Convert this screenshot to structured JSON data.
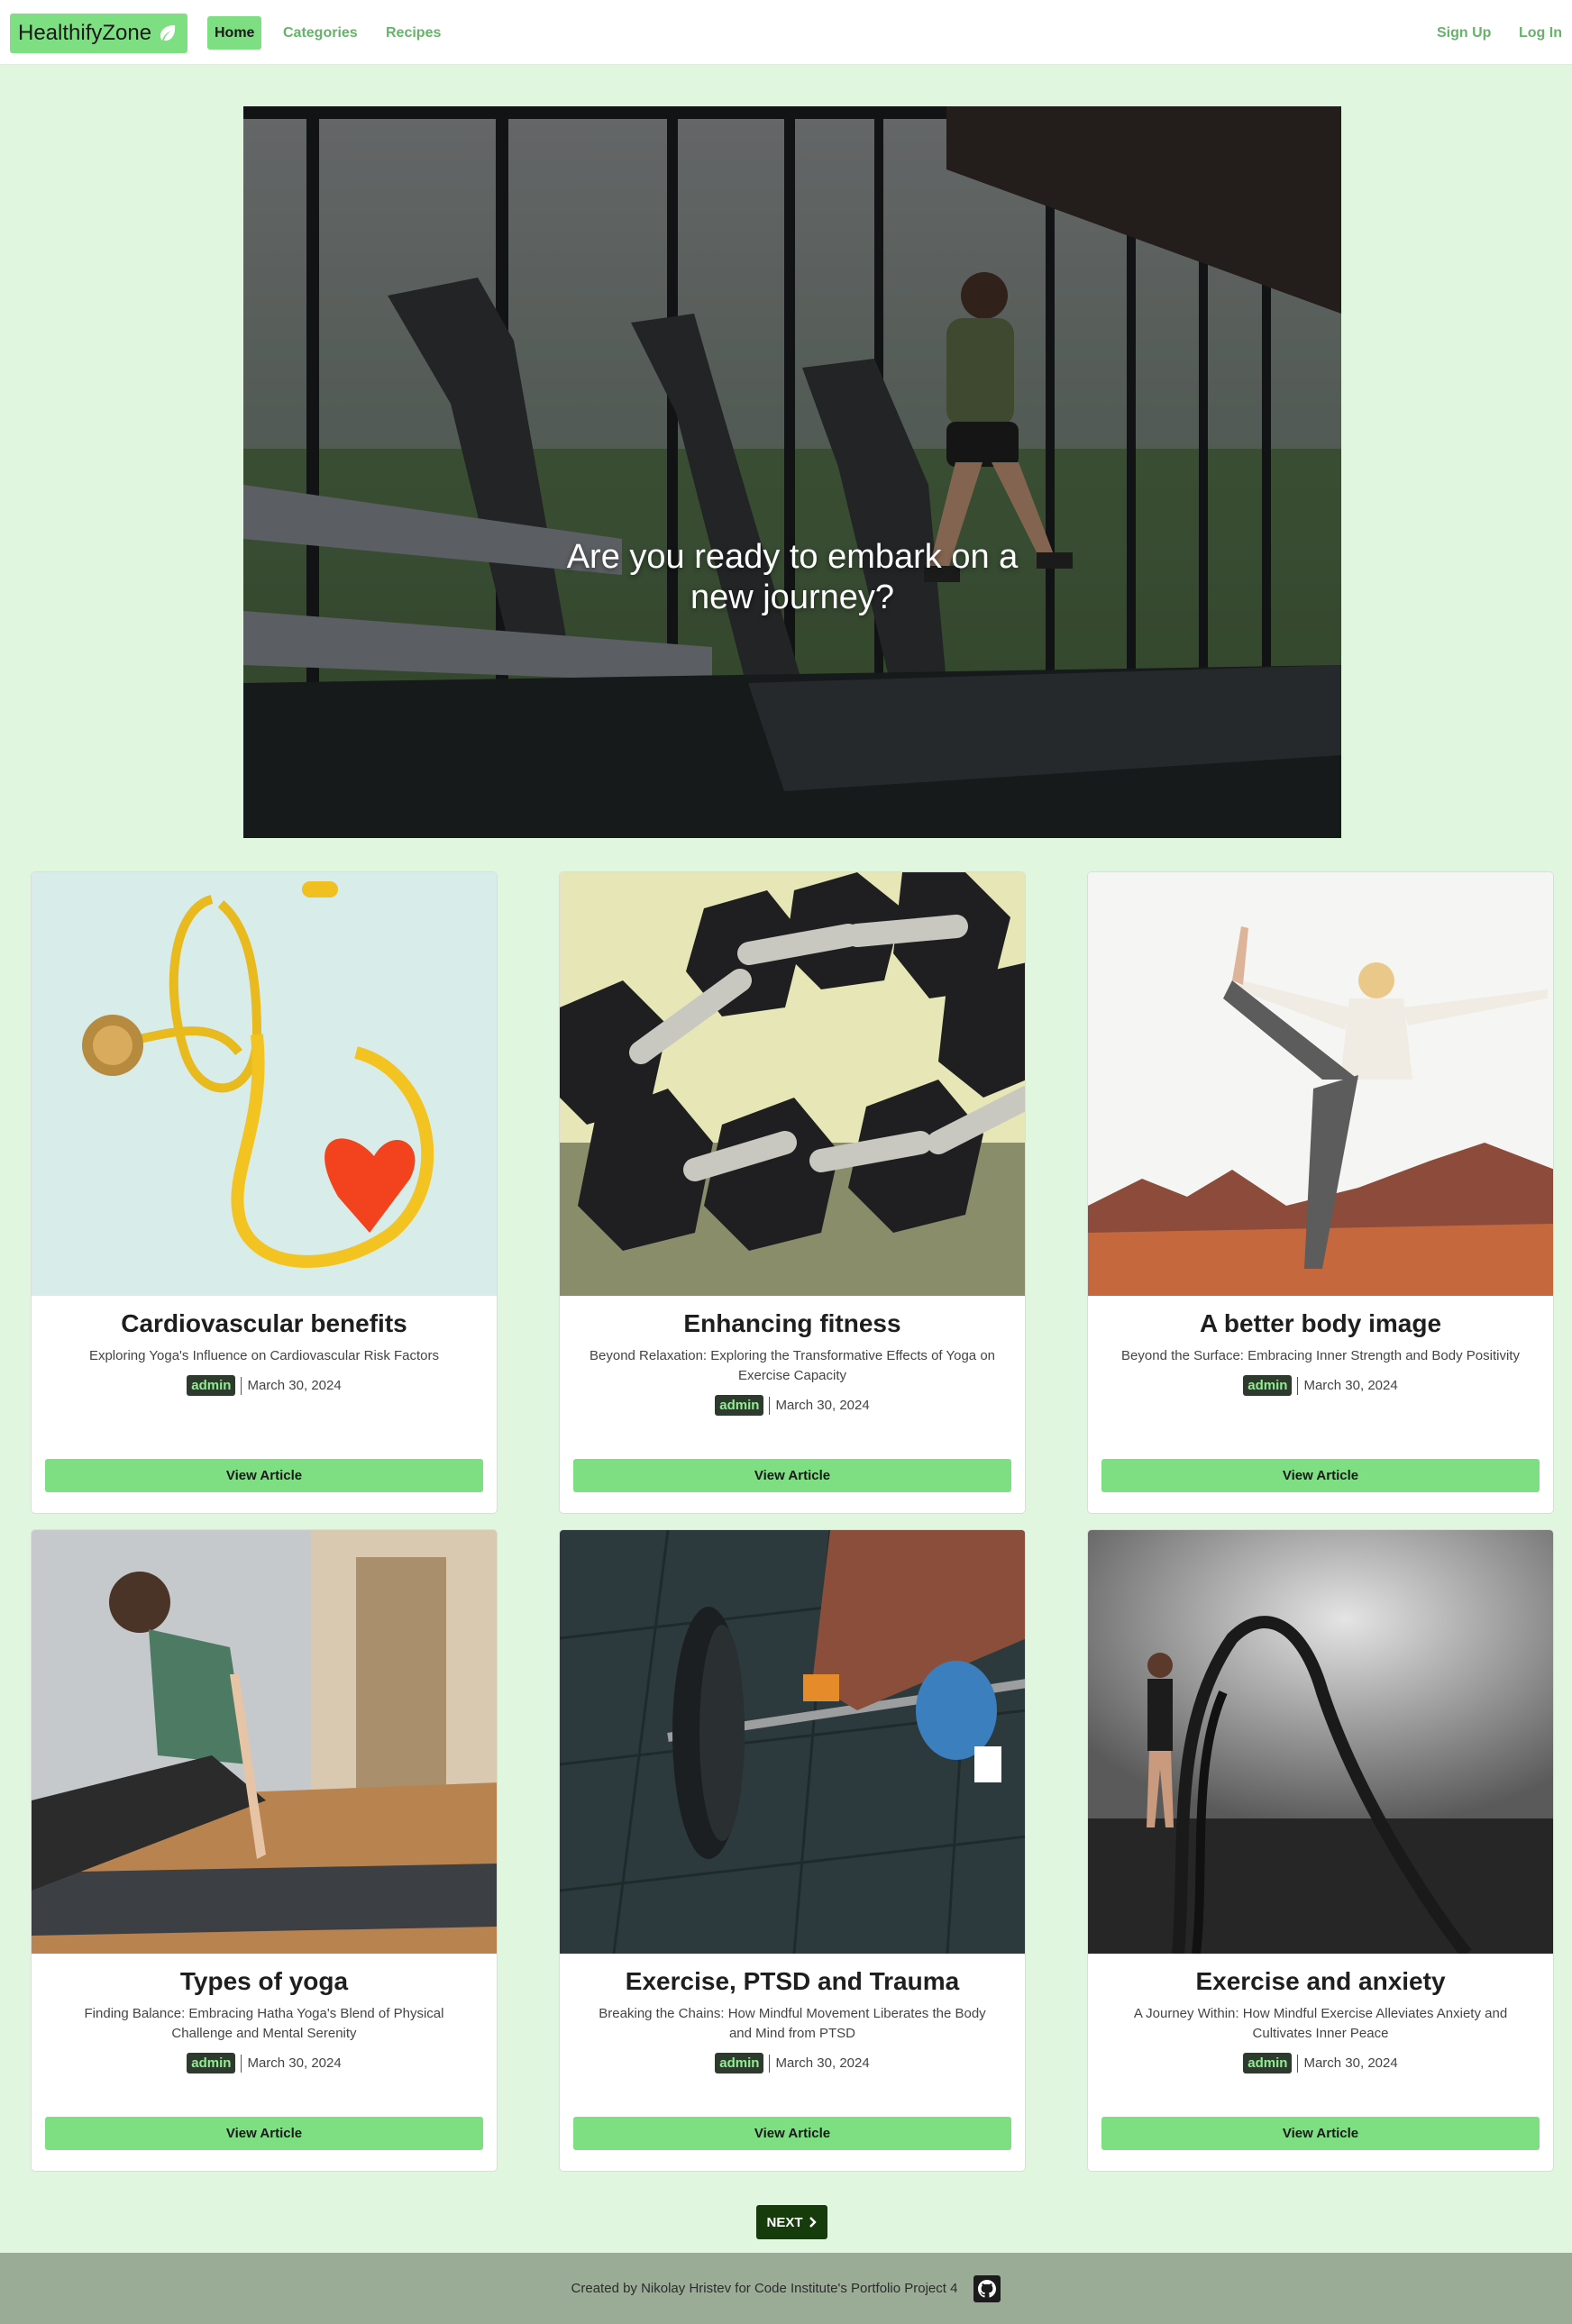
{
  "navbar": {
    "brand": "HealthifyZone",
    "links": [
      {
        "label": "Home",
        "active": true
      },
      {
        "label": "Categories",
        "active": false
      },
      {
        "label": "Recipes",
        "active": false
      }
    ],
    "auth": {
      "signup": "Sign Up",
      "login": "Log In"
    }
  },
  "hero": {
    "title_line1": "Are you ready to embark on a",
    "title_line2": "new journey?"
  },
  "articles": [
    {
      "title": "Cardiovascular benefits",
      "excerpt": "Exploring Yoga's Influence on Cardiovascular Risk Factors",
      "author": "admin",
      "date": "March 30, 2024",
      "button": "View Article",
      "image": "stethoscope-heart"
    },
    {
      "title": "Enhancing fitness",
      "excerpt": "Beyond Relaxation: Exploring the Transformative Effects of Yoga on Exercise Capacity",
      "author": "admin",
      "date": "March 30, 2024",
      "button": "View Article",
      "image": "dumbbells"
    },
    {
      "title": "A better body image",
      "excerpt": "Beyond the Surface: Embracing Inner Strength and Body Positivity",
      "author": "admin",
      "date": "March 30, 2024",
      "button": "View Article",
      "image": "yoga-pose-outdoor"
    },
    {
      "title": "Types of yoga",
      "excerpt": "Finding Balance: Embracing Hatha Yoga's Blend of Physical Challenge and Mental Serenity",
      "author": "admin",
      "date": "March 30, 2024",
      "button": "View Article",
      "image": "yoga-cobra"
    },
    {
      "title": "Exercise, PTSD and Trauma",
      "excerpt": "Breaking the Chains: How Mindful Movement Liberates the Body and Mind from PTSD",
      "author": "admin",
      "date": "March 30, 2024",
      "button": "View Article",
      "image": "barbell-lift"
    },
    {
      "title": "Exercise and anxiety",
      "excerpt": "A Journey Within: How Mindful Exercise Alleviates Anxiety and Cultivates Inner Peace",
      "author": "admin",
      "date": "March 30, 2024",
      "button": "View Article",
      "image": "battle-ropes"
    }
  ],
  "pagination": {
    "next_label": "NEXT"
  },
  "footer": {
    "text": "Created by Nikolay Hristev for Code Institute's Portfolio Project 4"
  },
  "colors": {
    "accent": "#7ddf82",
    "page_bg": "#e0f6df",
    "next_bg": "#173c0b",
    "footer_bg": "#9aab96"
  }
}
